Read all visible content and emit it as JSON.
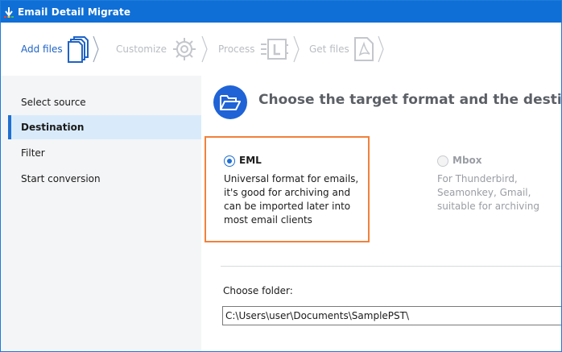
{
  "window": {
    "title": "Email Detail Migrate",
    "app_icon": "download-arrow-icon"
  },
  "steps": [
    {
      "label": "Add files",
      "icon": "files-icon",
      "state": "active"
    },
    {
      "label": "Customize",
      "icon": "gear-icon",
      "state": "inactive"
    },
    {
      "label": "Process",
      "icon": "process-icon",
      "state": "inactive"
    },
    {
      "label": "Get files",
      "icon": "pdf-icon",
      "state": "inactive"
    }
  ],
  "sidebar": {
    "items": [
      {
        "label": "Select source",
        "selected": false
      },
      {
        "label": "Destination",
        "selected": true
      },
      {
        "label": "Filter",
        "selected": false
      },
      {
        "label": "Start conversion",
        "selected": false
      }
    ]
  },
  "main": {
    "heading": "Choose the target format and the destination fo",
    "heading_icon": "folder-open-icon",
    "options": [
      {
        "title": "EML",
        "selected": true,
        "enabled": true,
        "description": "Universal format for emails,\nit's good for archiving and\ncan be imported later into\nmost email clients"
      },
      {
        "title": "Mbox",
        "selected": false,
        "enabled": false,
        "description": "For Thunderbird,\nSeamonkey, Gmail,\nsuitable for archiving"
      }
    ],
    "folder": {
      "label": "Choose folder:",
      "value": "C:\\Users\\user\\Documents\\SamplePST\\"
    }
  },
  "colors": {
    "title_bar": "#0f6fd6",
    "accent": "#1f63c6",
    "highlight_border": "#f2813a",
    "sidebar_selected": "#d9ebfb"
  }
}
